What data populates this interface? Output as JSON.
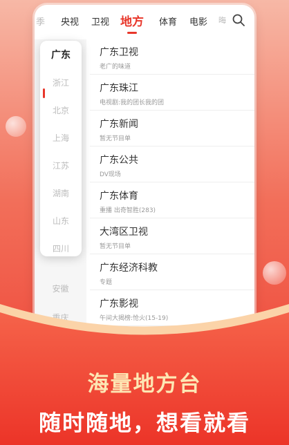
{
  "tabs": [
    "季",
    "央视",
    "卫视",
    "地方",
    "体育",
    "电影",
    "晦"
  ],
  "active_tab": "地方",
  "sidebar": [
    "浙江",
    "北京",
    "上海",
    "江苏",
    "湖南",
    "山东",
    "四川",
    "安徽",
    "重庆"
  ],
  "popup": {
    "selected": "广东",
    "items": [
      "浙江",
      "北京",
      "上海",
      "江苏",
      "湖南",
      "山东",
      "四川"
    ]
  },
  "channels": [
    {
      "title": "广东卫视",
      "sub": "老广的味道"
    },
    {
      "title": "广东珠江",
      "sub": "电视剧:我的团长我的团"
    },
    {
      "title": "广东新闻",
      "sub": "暂无节目单"
    },
    {
      "title": "广东公共",
      "sub": "DV现场"
    },
    {
      "title": "广东体育",
      "sub": "重播 出奇智胜(283)"
    },
    {
      "title": "大湾区卫视",
      "sub": "暂无节目单"
    },
    {
      "title": "广东经济科教",
      "sub": "专题"
    },
    {
      "title": "广东影视",
      "sub": "午间大揭榜:怆火(15-19)"
    }
  ],
  "promo": {
    "headline": "海量地方台",
    "subline": "随时随地，想看就看"
  },
  "colors": {
    "accent": "#e8362a",
    "headline": "#fde7b4",
    "background": "#ee3b2e"
  }
}
